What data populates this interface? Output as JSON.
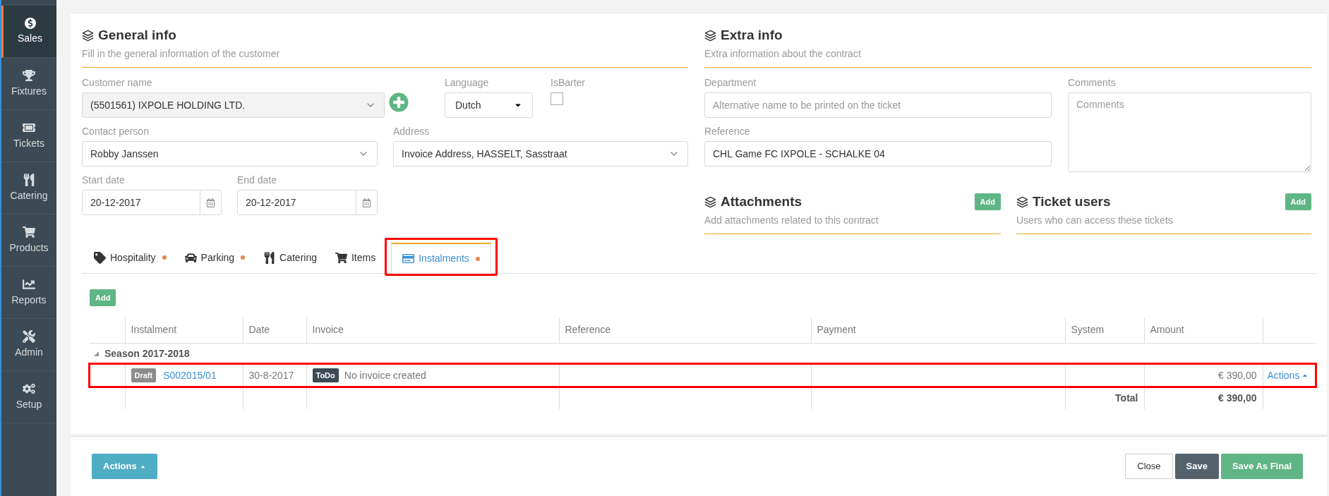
{
  "sidebar": {
    "items": [
      {
        "label": "Sales",
        "selected": true
      },
      {
        "label": "Fixtures",
        "selected": false
      },
      {
        "label": "Tickets",
        "selected": false
      },
      {
        "label": "Catering",
        "selected": false
      },
      {
        "label": "Products",
        "selected": false
      },
      {
        "label": "Reports",
        "selected": false
      },
      {
        "label": "Admin",
        "selected": false
      },
      {
        "label": "Setup",
        "selected": false
      }
    ]
  },
  "general_info": {
    "title": "General info",
    "subtitle": "Fill in the general information of the customer",
    "customer_name": {
      "label": "Customer name",
      "value": "(5501561) IXPOLE HOLDING LTD."
    },
    "language": {
      "label": "Language",
      "value": "Dutch"
    },
    "is_barter": {
      "label": "IsBarter",
      "checked": false
    },
    "contact_person": {
      "label": "Contact person",
      "value": "Robby Janssen"
    },
    "address": {
      "label": "Address",
      "value": "Invoice Address, HASSELT, Sasstraat"
    },
    "start_date": {
      "label": "Start date",
      "value": "20-12-2017"
    },
    "end_date": {
      "label": "End date",
      "value": "20-12-2017"
    }
  },
  "extra_info": {
    "title": "Extra info",
    "subtitle": "Extra information about the contract",
    "department": {
      "label": "Department",
      "placeholder": "Alternative name to be printed on the ticket"
    },
    "reference": {
      "label": "Reference",
      "value": "CHL Game FC IXPOLE - SCHALKE 04"
    },
    "comments": {
      "label": "Comments",
      "placeholder": "Comments"
    }
  },
  "attachments": {
    "title": "Attachments",
    "subtitle": "Add attachments related to this contract",
    "button": "Add"
  },
  "ticket_users": {
    "title": "Ticket users",
    "subtitle": "Users who can access these tickets",
    "button": "Add"
  },
  "tabs": [
    {
      "label": "Hospitality",
      "selected": false,
      "dot": true,
      "highlighted": false
    },
    {
      "label": "Parking",
      "selected": false,
      "dot": true,
      "highlighted": false
    },
    {
      "label": "Catering",
      "selected": false,
      "dot": false,
      "highlighted": false
    },
    {
      "label": "Items",
      "selected": false,
      "dot": false,
      "highlighted": false
    },
    {
      "label": "Instalments",
      "selected": true,
      "dot": true,
      "highlighted": true
    }
  ],
  "add_button": "Add",
  "table": {
    "columns": [
      "Instalment",
      "Date",
      "Invoice",
      "Reference",
      "Payment",
      "System",
      "Amount"
    ],
    "groups": [
      {
        "title": "Season 2017-2018",
        "expanded": true,
        "rows": [
          {
            "status": "Draft",
            "instalment": "S002015/01",
            "date": "30-8-2017",
            "invoice_status": "ToDo",
            "invoice": "No invoice created",
            "amount": "€ 390,00",
            "action": "Actions",
            "highlighted": true
          }
        ]
      }
    ],
    "total_label": "Total",
    "total": "€ 390,00"
  },
  "footer": {
    "actions": "Actions",
    "close": "Close",
    "save": "Save",
    "save_final": "Save As Final"
  }
}
